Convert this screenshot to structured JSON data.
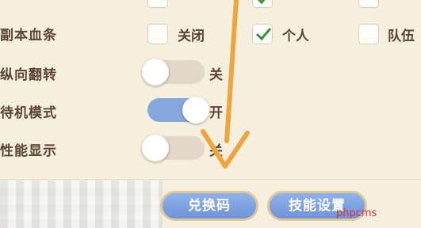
{
  "settings": {
    "dungeon_bar": {
      "label": "副本血条",
      "options": [
        {
          "label": "关闭",
          "checked": false
        },
        {
          "label": "个人",
          "checked": true
        },
        {
          "label": "队伍",
          "checked": false
        }
      ]
    },
    "vertical_flip": {
      "label": "纵向翻转",
      "state_text": "关",
      "on": false
    },
    "standby_mode": {
      "label": "待机模式",
      "state_text": "开",
      "on": true
    },
    "performance_display": {
      "label": "性能显示",
      "state_text": "关",
      "on": false
    }
  },
  "footer": {
    "redeem_code_label": "兑换码",
    "skill_settings_label": "技能设置"
  },
  "watermark": "phpcms",
  "colors": {
    "background": "#f6efde",
    "toggle_on": "#86a7de",
    "toggle_off": "#e2d7c8",
    "check": "#3e8f3e",
    "arrow": "#f0a43c",
    "button": "#7fa2df"
  }
}
